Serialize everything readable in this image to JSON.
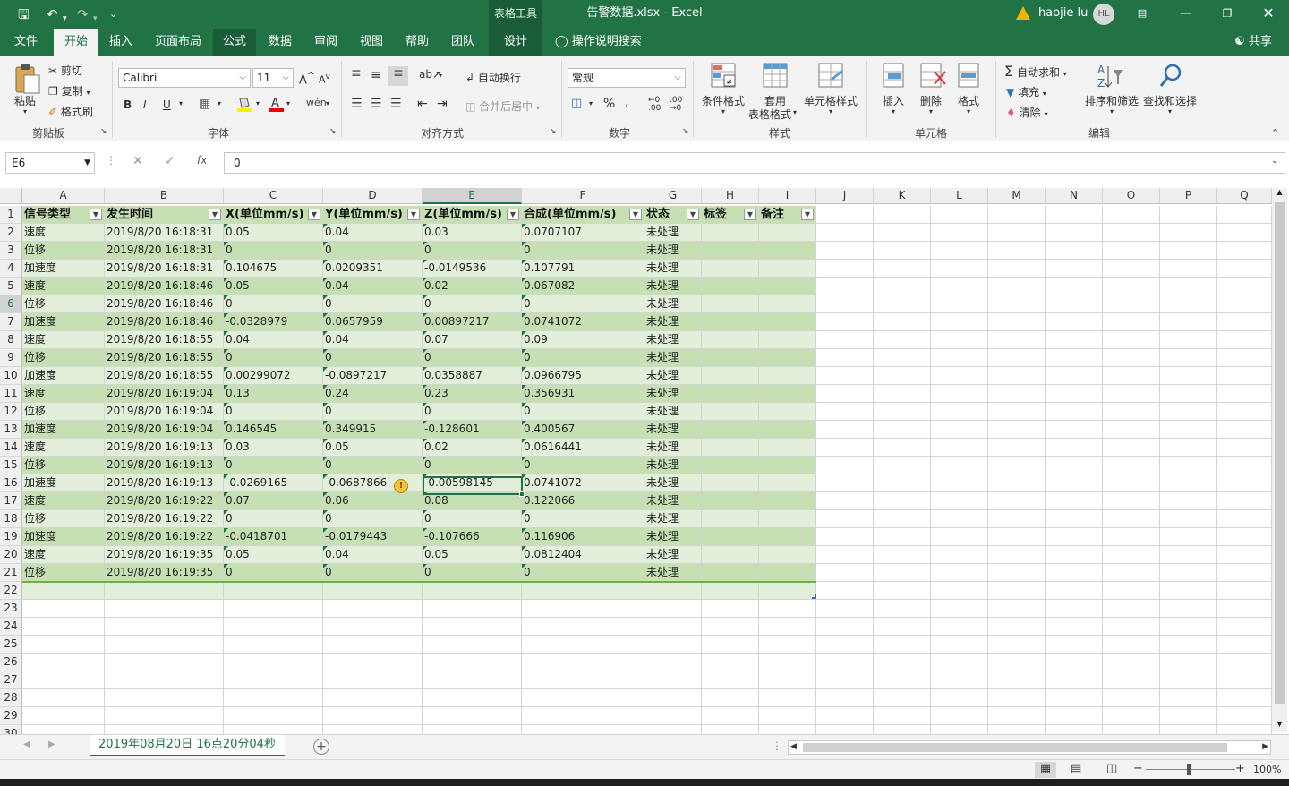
{
  "titlebar": {
    "file_title": "告警数据.xlsx  -  Excel",
    "context_tab": "表格工具",
    "user": "haojie lu",
    "user_initials": "HL",
    "accent": "#217346"
  },
  "tabs": [
    "文件",
    "开始",
    "插入",
    "页面布局",
    "公式",
    "数据",
    "审阅",
    "视图",
    "帮助",
    "团队",
    "设计"
  ],
  "tell_me": "操作说明搜索",
  "share": "共享",
  "ribbon": {
    "clipboard": {
      "label": "剪贴板",
      "paste": "粘贴",
      "cut": "剪切",
      "copy": "复制",
      "painter": "格式刷"
    },
    "font": {
      "label": "字体",
      "name": "Calibri",
      "size": "11"
    },
    "align": {
      "label": "对齐方式",
      "wrap": "自动换行",
      "merge": "合并后居中"
    },
    "number": {
      "label": "数字",
      "format": "常规"
    },
    "styles": {
      "label": "样式",
      "cond": "条件格式",
      "table1": "套用",
      "table2": "表格格式",
      "cell": "单元格样式"
    },
    "cells": {
      "label": "单元格",
      "insert": "插入",
      "delete": "删除",
      "format": "格式"
    },
    "edit": {
      "label": "编辑",
      "autosum": "自动求和",
      "fill": "填充",
      "clear": "清除",
      "sort": "排序和筛选",
      "find": "查找和选择"
    }
  },
  "formula": {
    "namebox": "E6",
    "value": "0"
  },
  "columns": [
    "A",
    "B",
    "C",
    "D",
    "E",
    "F",
    "G",
    "H",
    "I",
    "J",
    "K",
    "L",
    "M",
    "N",
    "O",
    "P",
    "Q"
  ],
  "selected_column": "E",
  "headers": [
    "信号类型",
    "发生时间",
    "X(单位mm/s)",
    "Y(单位mm/s)",
    "Z(单位mm/s)",
    "合成(单位mm/s)",
    "状态",
    "标签",
    "备注"
  ],
  "rows": [
    [
      "速度",
      "2019/8/20 16:18:31",
      "0.05",
      "0.04",
      "0.03",
      "0.0707107",
      "未处理"
    ],
    [
      "位移",
      "2019/8/20 16:18:31",
      "0",
      "0",
      "0",
      "0",
      "未处理"
    ],
    [
      "加速度",
      "2019/8/20 16:18:31",
      "0.104675",
      "0.0209351",
      "-0.0149536",
      "0.107791",
      "未处理"
    ],
    [
      "速度",
      "2019/8/20 16:18:46",
      "0.05",
      "0.04",
      "0.02",
      "0.067082",
      "未处理"
    ],
    [
      "位移",
      "2019/8/20 16:18:46",
      "0",
      "0",
      "0",
      "0",
      "未处理"
    ],
    [
      "加速度",
      "2019/8/20 16:18:46",
      "-0.0328979",
      "0.0657959",
      "0.00897217",
      "0.0741072",
      "未处理"
    ],
    [
      "速度",
      "2019/8/20 16:18:55",
      "0.04",
      "0.04",
      "0.07",
      "0.09",
      "未处理"
    ],
    [
      "位移",
      "2019/8/20 16:18:55",
      "0",
      "0",
      "0",
      "0",
      "未处理"
    ],
    [
      "加速度",
      "2019/8/20 16:18:55",
      "0.00299072",
      "-0.0897217",
      "0.0358887",
      "0.0966795",
      "未处理"
    ],
    [
      "速度",
      "2019/8/20 16:19:04",
      "0.13",
      "0.24",
      "0.23",
      "0.356931",
      "未处理"
    ],
    [
      "位移",
      "2019/8/20 16:19:04",
      "0",
      "0",
      "0",
      "0",
      "未处理"
    ],
    [
      "加速度",
      "2019/8/20 16:19:04",
      "0.146545",
      "0.349915",
      "-0.128601",
      "0.400567",
      "未处理"
    ],
    [
      "速度",
      "2019/8/20 16:19:13",
      "0.03",
      "0.05",
      "0.02",
      "0.0616441",
      "未处理"
    ],
    [
      "位移",
      "2019/8/20 16:19:13",
      "0",
      "0",
      "0",
      "0",
      "未处理"
    ],
    [
      "加速度",
      "2019/8/20 16:19:13",
      "-0.0269165",
      "-0.0687866",
      "-0.00598145",
      "0.0741072",
      "未处理"
    ],
    [
      "速度",
      "2019/8/20 16:19:22",
      "0.07",
      "0.06",
      "0.08",
      "0.122066",
      "未处理"
    ],
    [
      "位移",
      "2019/8/20 16:19:22",
      "0",
      "0",
      "0",
      "0",
      "未处理"
    ],
    [
      "加速度",
      "2019/8/20 16:19:22",
      "-0.0418701",
      "-0.0179443",
      "-0.107666",
      "0.116906",
      "未处理"
    ],
    [
      "速度",
      "2019/8/20 16:19:35",
      "0.05",
      "0.04",
      "0.05",
      "0.0812404",
      "未处理"
    ],
    [
      "位移",
      "2019/8/20 16:19:35",
      "0",
      "0",
      "0",
      "0",
      "未处理"
    ]
  ],
  "sheet_tab": "2019年08月20日 16点20分04秒",
  "zoom": "100%"
}
